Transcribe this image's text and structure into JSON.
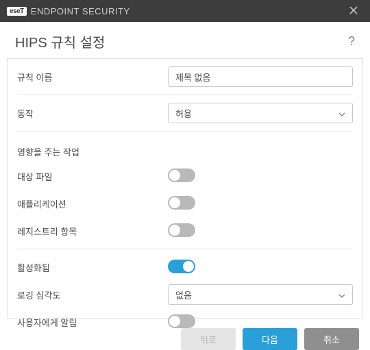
{
  "titlebar": {
    "brand_badge": "eseT",
    "product": "ENDPOINT SECURITY"
  },
  "header": {
    "title": "HIPS 규칙 설정",
    "help": "?"
  },
  "fields": {
    "rule_name": {
      "label": "규칙 이름",
      "value": "제목 없음"
    },
    "action": {
      "label": "동작",
      "selected": "허용"
    },
    "operations_section": "영향을 주는 작업",
    "target_files": {
      "label": "대상 파일",
      "on": false
    },
    "applications": {
      "label": "애플리케이션",
      "on": false
    },
    "registry_entries": {
      "label": "레지스트리 항목",
      "on": false
    },
    "enabled": {
      "label": "활성화됨",
      "on": true
    },
    "logging_severity": {
      "label": "로깅 심각도",
      "selected": "없음"
    },
    "notify_user": {
      "label": "사용자에게 알림",
      "on": false
    }
  },
  "footer": {
    "back": "뒤로",
    "next": "다음",
    "cancel": "취소"
  }
}
